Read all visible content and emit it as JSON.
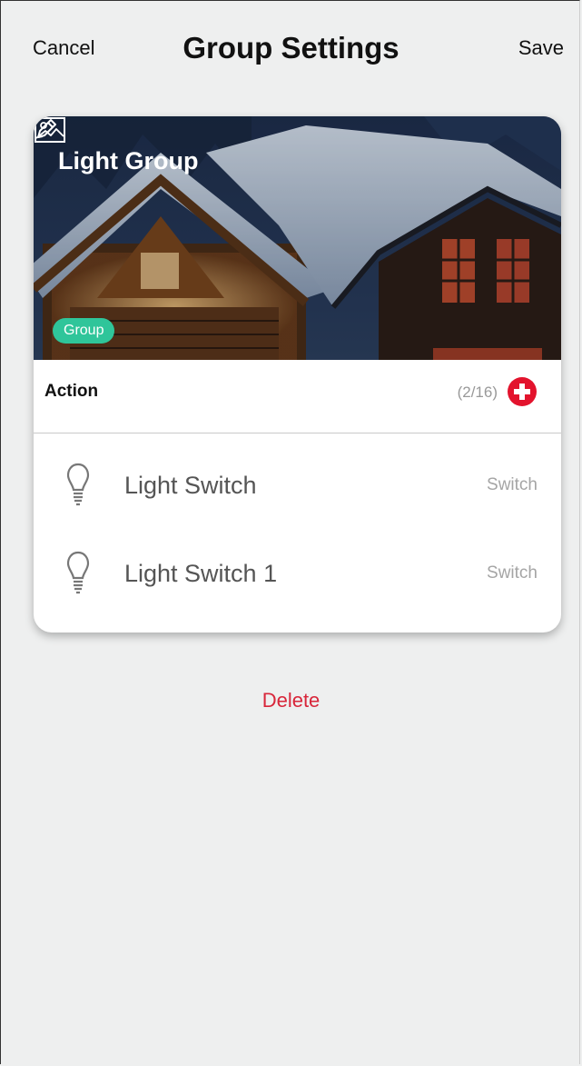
{
  "header": {
    "cancel_label": "Cancel",
    "title": "Group Settings",
    "save_label": "Save"
  },
  "group": {
    "name": "Light Group",
    "badge": "Group",
    "edit_icon": "pencil-icon",
    "image_icon": "image-icon"
  },
  "action": {
    "label": "Action",
    "count": "(2/16)",
    "add_icon": "plus-circle-icon",
    "add_color": "#e3132d"
  },
  "devices": [
    {
      "icon": "lightbulb-icon",
      "name": "Light Switch",
      "type": "Switch"
    },
    {
      "icon": "lightbulb-icon",
      "name": "Light Switch 1",
      "type": "Switch"
    }
  ],
  "delete_label": "Delete",
  "colors": {
    "background": "#eeefef",
    "badge": "#2fc59a",
    "delete": "#d8263a"
  }
}
